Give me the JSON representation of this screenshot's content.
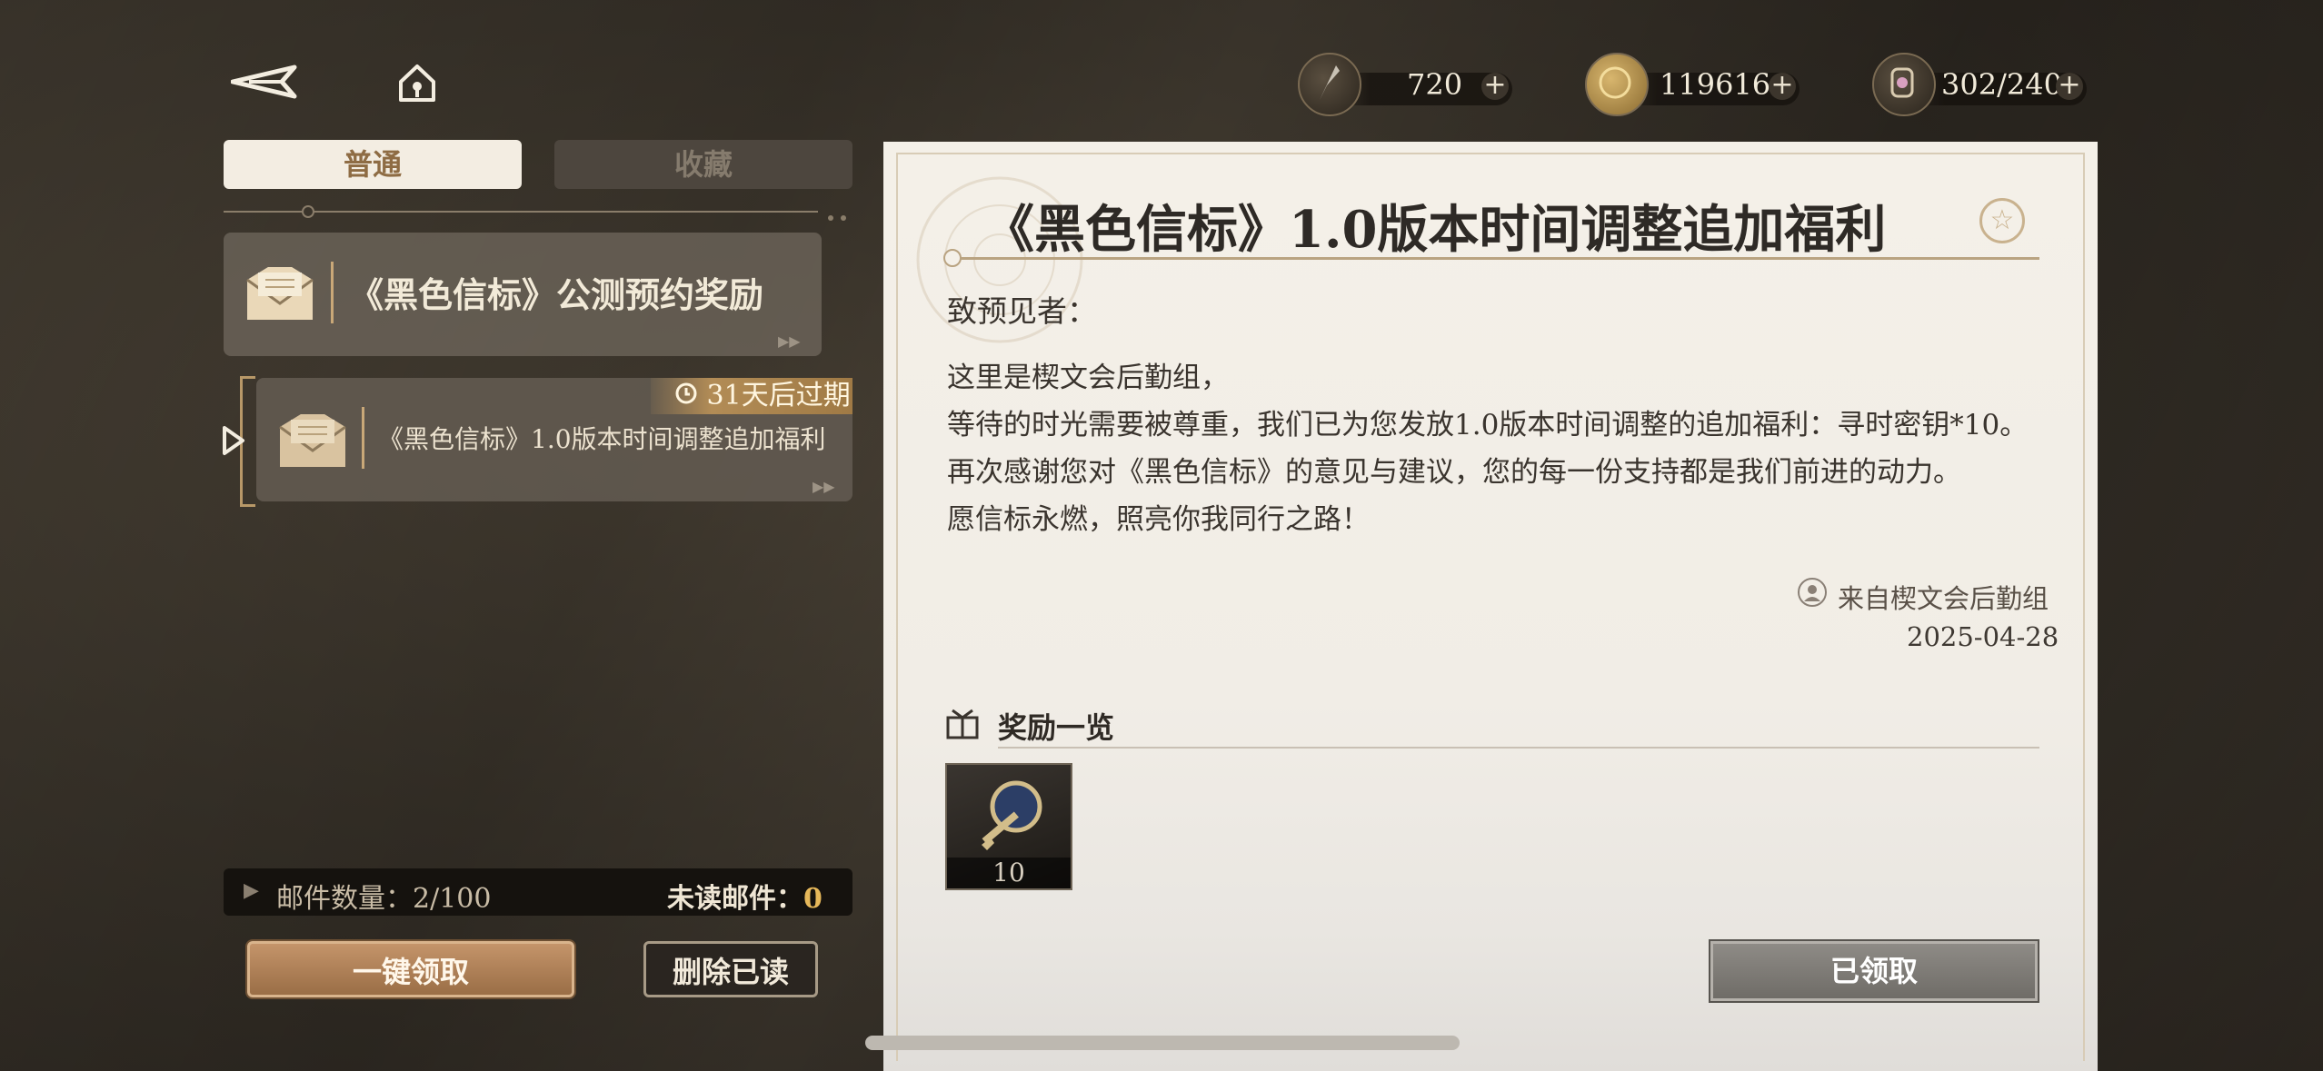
{
  "header": {
    "back_icon": "back-arrow-icon",
    "home_icon": "home-icon",
    "resources": [
      {
        "icon": "quill-icon",
        "value": "720"
      },
      {
        "icon": "coin-icon",
        "value": "119616"
      },
      {
        "icon": "lantern-icon",
        "value": "302/240"
      }
    ]
  },
  "tabs": [
    {
      "label": "普通",
      "active": true
    },
    {
      "label": "收藏",
      "active": false
    }
  ],
  "mail_list": [
    {
      "title": "《黑色信标》公测预约奖励"
    },
    {
      "title": "《黑色信标》1.0版本时间调整追加福利",
      "expiry": "31天后过期",
      "selected": true
    }
  ],
  "footer_left": {
    "count_label": "邮件数量：",
    "count_value": "2/100",
    "unread_label": "未读邮件：",
    "unread_value": "0",
    "claim_all": "一键领取",
    "delete_read": "删除已读"
  },
  "mail_detail": {
    "title": "《黑色信标》1.0版本时间调整追加福利",
    "greeting": "致预见者：",
    "lines": [
      "这里是楔文会后勤组，",
      "等待的时光需要被尊重，我们已为您发放1.0版本时间调整的追加福利：寻时密钥*10。",
      "再次感谢您对《黑色信标》的意见与建议，您的每一份支持都是我们前进的动力。",
      "愿信标永燃，照亮你我同行之路！"
    ],
    "sender": "来自楔文会后勤组",
    "date": "2025-04-28",
    "rewards_title": "奖励一览",
    "reward_item": {
      "icon": "key-icon",
      "qty": "10"
    },
    "claimed_button": "已领取"
  },
  "colors": {
    "accent": "#b28c56",
    "panel_bg": "#f4f0e8",
    "bg": "#3a342b"
  }
}
